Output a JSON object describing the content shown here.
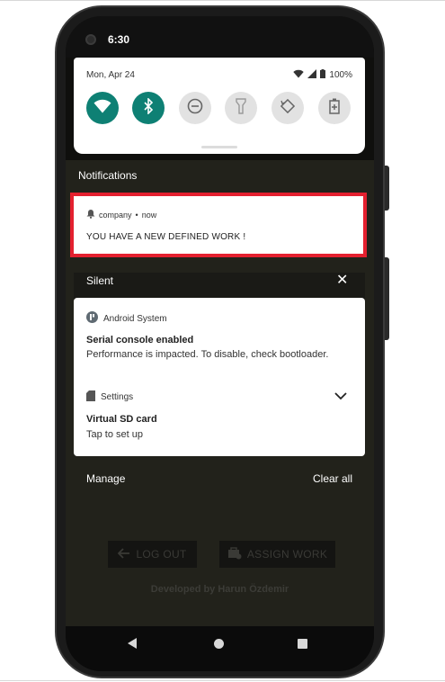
{
  "status_bar": {
    "time": "6:30"
  },
  "quick_settings": {
    "date": "Mon, Apr 24",
    "battery": "100%",
    "tiles": [
      {
        "icon": "wifi-icon",
        "state": "on"
      },
      {
        "icon": "bluetooth-icon",
        "state": "on"
      },
      {
        "icon": "do-not-disturb-icon",
        "state": "off"
      },
      {
        "icon": "flashlight-icon",
        "state": "off"
      },
      {
        "icon": "auto-rotate-icon",
        "state": "off"
      },
      {
        "icon": "battery-saver-icon",
        "state": "off"
      }
    ]
  },
  "notifications": {
    "header": "Notifications",
    "item": {
      "app": "company",
      "time": "now",
      "body": "YOU HAVE A NEW DEFINED WORK !"
    }
  },
  "silent": {
    "header": "Silent",
    "close": "✕",
    "items": [
      {
        "app": "Android System",
        "title": "Serial console enabled",
        "text": "Performance is impacted. To disable, check bootloader."
      },
      {
        "app": "Settings",
        "title": "Virtual SD card",
        "text": "Tap to set up"
      }
    ]
  },
  "footer": {
    "manage": "Manage",
    "clear_all": "Clear all"
  },
  "app": {
    "logout_label": "LOG OUT",
    "assign_label": "ASSIGN WORK",
    "developer": "Developed by Harun Özdemir"
  },
  "colors": {
    "accent": "#0e8074",
    "highlight": "#e4202f"
  }
}
